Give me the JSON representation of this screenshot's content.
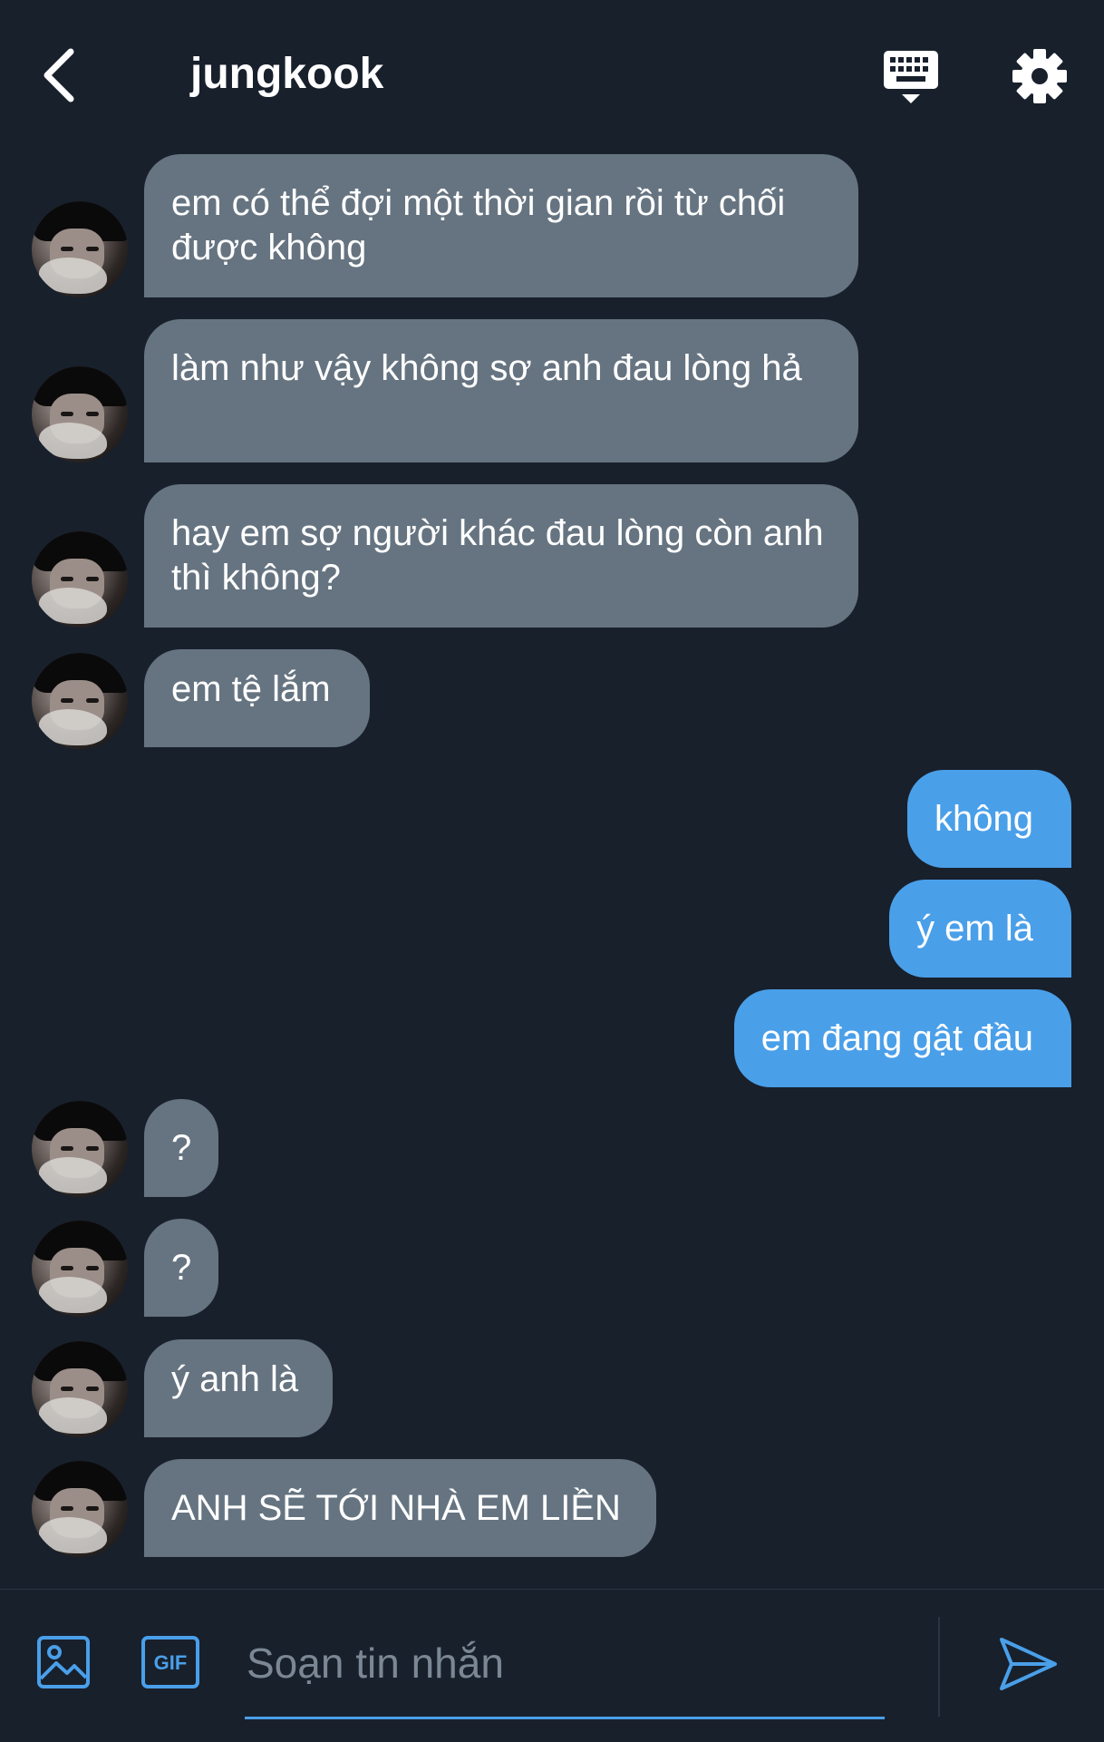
{
  "header": {
    "title": "jungkook",
    "back_icon": "chevron-left-icon",
    "keyboard_icon": "keyboard-icon",
    "settings_icon": "gear-icon"
  },
  "colors": {
    "background": "#18202c",
    "incoming_bubble": "#667481",
    "outgoing_bubble": "#4a9fe9",
    "accent": "#4a9fe9"
  },
  "messages": [
    {
      "direction": "in",
      "text": "em có thể đợi một thời gian rồi từ chối được không"
    },
    {
      "direction": "in",
      "text": "làm như vậy không sợ anh đau lòng hả"
    },
    {
      "direction": "in",
      "text": "hay em sợ người khác đau lòng còn anh thì không?"
    },
    {
      "direction": "in",
      "text": "em tệ lắm"
    },
    {
      "direction": "out",
      "text": "không"
    },
    {
      "direction": "out",
      "text": "ý em là"
    },
    {
      "direction": "out",
      "text": "em đang gật đầu"
    },
    {
      "direction": "in",
      "text": "?"
    },
    {
      "direction": "in",
      "text": "?"
    },
    {
      "direction": "in",
      "text": "ý anh là"
    },
    {
      "direction": "in",
      "text": "ANH SẼ TỚI NHÀ EM LIỀN"
    }
  ],
  "compose": {
    "placeholder": "Soạn tin nhắn",
    "value": "",
    "image_icon": "image-icon",
    "gif_icon": "gif-icon",
    "gif_label": "GIF",
    "send_icon": "send-icon"
  }
}
